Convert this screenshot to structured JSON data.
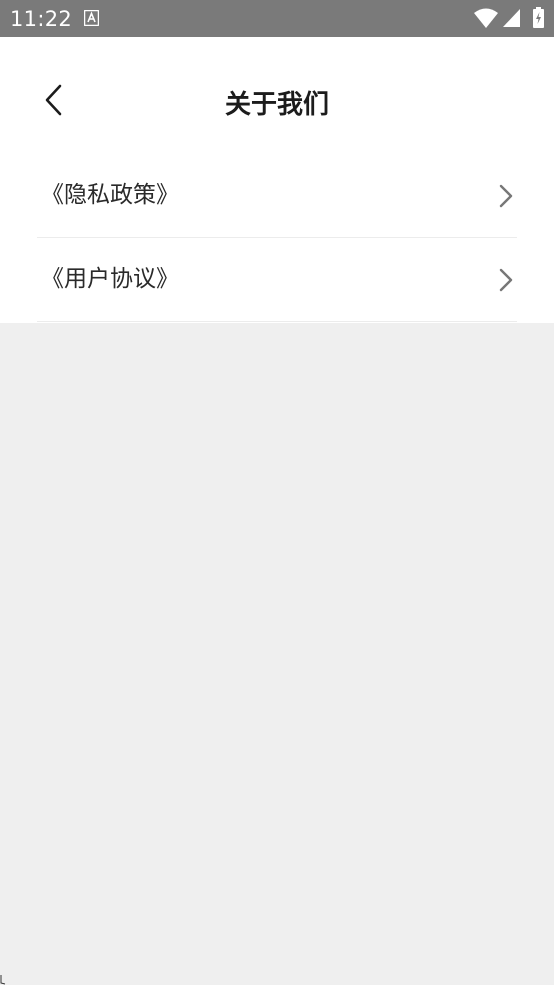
{
  "status_bar": {
    "time": "11:22",
    "icons": [
      "font-a-icon",
      "wifi-icon",
      "signal-icon",
      "battery-icon"
    ]
  },
  "header": {
    "title": "关于我们",
    "back_icon": "chevron-left-icon"
  },
  "menu": {
    "items": [
      {
        "label": "《隐私政策》",
        "icon": "chevron-right-icon"
      },
      {
        "label": "《用户协议》",
        "icon": "chevron-right-icon"
      }
    ]
  },
  "colors": {
    "status_bar_bg": "#7a7a7a",
    "content_bg": "#ffffff",
    "page_bg": "#efefef",
    "divider": "#ececec",
    "text": "#2a2a2a",
    "chevron": "#777777"
  }
}
